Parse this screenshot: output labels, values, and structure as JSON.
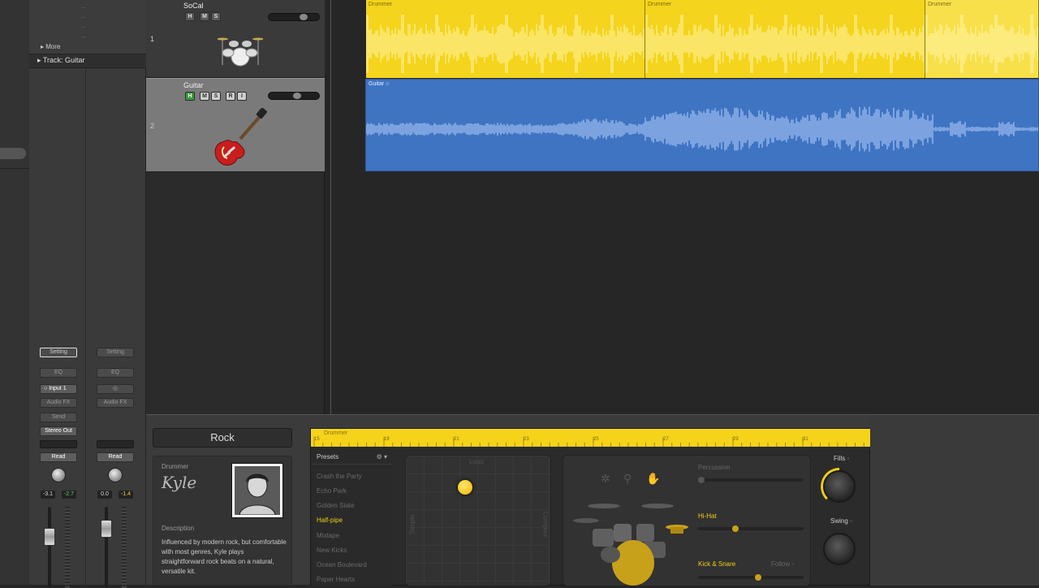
{
  "colors": {
    "accent_yellow": "#f5d31a",
    "region_blue": "#3f74c2",
    "region_yellow": "#f4d41c",
    "active_preset": "#f2cd17",
    "mute_green": "#3a9a3a"
  },
  "inspector": {
    "more_label": "More",
    "track_label": "Track: Guitar",
    "channels": [
      {
        "setting": "Setting",
        "eq": "EQ",
        "input": "Input 1",
        "audio_fx": "Audio FX",
        "send": "Send",
        "output": "Stereo Out",
        "automation": "Read",
        "pan_left": "-3.1",
        "pan_right": "-2.7"
      },
      {
        "setting": "Setting",
        "eq": "EQ",
        "audio_fx": "Audio FX",
        "automation": "Read",
        "pan_left": "0.0",
        "pan_right": "-1.4"
      }
    ]
  },
  "tracks": [
    {
      "number": "1",
      "name": "SoCal",
      "buttons": [
        "H",
        "M",
        "S"
      ],
      "icon": "drum-kit-icon"
    },
    {
      "number": "2",
      "name": "Guitar",
      "buttons": [
        "H",
        "M",
        "S",
        "R",
        "I"
      ],
      "icon": "electric-guitar-icon"
    }
  ],
  "regions": {
    "drummer": [
      "Drummer",
      "Drummer",
      "Drummer"
    ],
    "guitar": "Guitar"
  },
  "drummer_editor": {
    "genre": "Rock",
    "drummer_label": "Drummer",
    "drummer_name": "Kyle",
    "description_label": "Description",
    "description": "Influenced by modern rock, but comfortable with most genres, Kyle plays straightforward rock beats on a natural, versatile kit.",
    "ruler_label": "Drummer",
    "ruler_numbers": [
      "15",
      "19",
      "21",
      "23",
      "25",
      "27",
      "29",
      "31"
    ],
    "presets_label": "Presets",
    "presets": [
      "Crash the Party",
      "Echo Park",
      "Golden State",
      "Half-pipe",
      "Mixtape",
      "New Kicks",
      "Ocean Boulevard",
      "Paper Hearts"
    ],
    "active_preset": "Half-pipe",
    "xy_labels": {
      "top": "Loud",
      "left": "Simple",
      "right": "Complex"
    },
    "instruments": {
      "percussion": "Percussion",
      "hihat": "Hi-Hat",
      "kick_snare": "Kick & Snare",
      "follow": "Follow"
    },
    "fills_label": "Fills",
    "swing_label": "Swing"
  }
}
